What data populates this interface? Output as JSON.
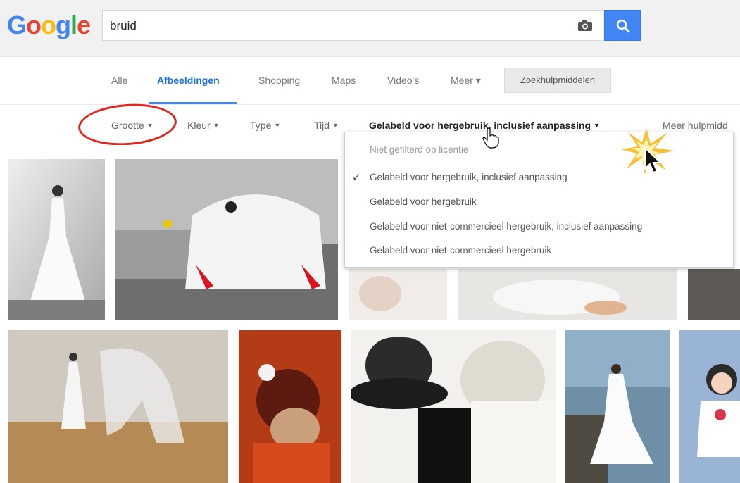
{
  "logo": {
    "letters": [
      "G",
      "o",
      "o",
      "g",
      "l",
      "e"
    ]
  },
  "search": {
    "query": "bruid"
  },
  "icons": {
    "camera": "camera-icon",
    "search": "magnifier-icon",
    "pointer": "arrow-cursor-icon",
    "hand": "hand-cursor-icon"
  },
  "tabs": [
    {
      "label": "Alle",
      "active": false
    },
    {
      "label": "Afbeeldingen",
      "active": true
    },
    {
      "label": "Shopping",
      "active": false
    },
    {
      "label": "Maps",
      "active": false
    },
    {
      "label": "Video's",
      "active": false
    },
    {
      "label": "Meer ▾",
      "active": false
    }
  ],
  "tools_label": "Zoekhulpmiddelen",
  "filters": {
    "size": "Grootte",
    "color": "Kleur",
    "type": "Type",
    "time": "Tijd",
    "license": "Gelabeld voor hergebruik, inclusief aanpassing",
    "more": "Meer hulpmidd"
  },
  "license_menu": {
    "items": [
      {
        "label": "Niet gefilterd op licentie",
        "checked": false
      },
      {
        "label": "Gelabeld voor hergebruik, inclusief aanpassing",
        "checked": true
      },
      {
        "label": "Gelabeld voor hergebruik",
        "checked": false
      },
      {
        "label": "Gelabeld voor niet-commercieel hergebruik, inclusief aanpassing",
        "checked": false
      },
      {
        "label": "Gelabeld voor niet-commercieel hergebruik",
        "checked": false
      }
    ],
    "check_mark": "✓"
  },
  "colors": {
    "accent": "#4285f4",
    "highlight_circle": "#e0251e",
    "burst": "#f5b820"
  }
}
